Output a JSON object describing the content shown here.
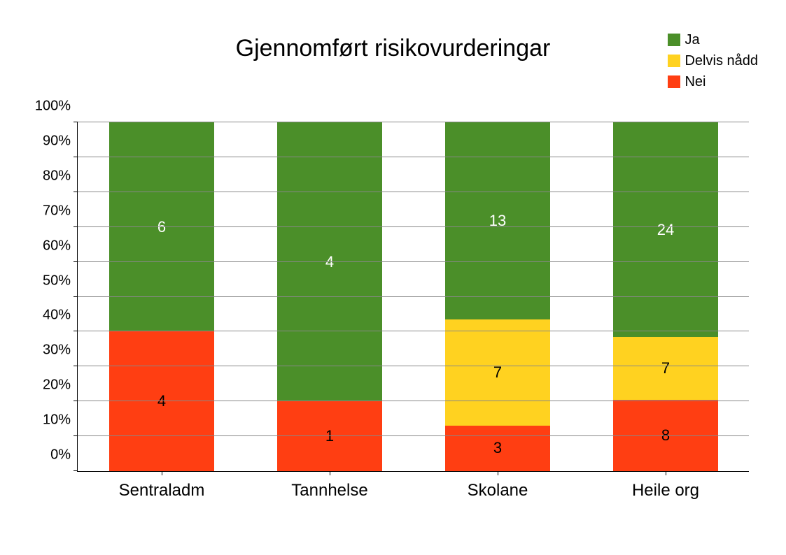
{
  "title": "Gjennomført risikovurderingar",
  "legend": {
    "ja": {
      "label": "Ja",
      "color": "#4b8f29"
    },
    "delvis": {
      "label": "Delvis nådd",
      "color": "#ffd220"
    },
    "nei": {
      "label": "Nei",
      "color": "#ff3e12"
    }
  },
  "yticks": [
    "0%",
    "10%",
    "20%",
    "30%",
    "40%",
    "50%",
    "60%",
    "70%",
    "80%",
    "90%",
    "100%"
  ],
  "categories": [
    "Sentraladm",
    "Tannhelse",
    "Skolane",
    "Heile org"
  ],
  "chart_data": {
    "type": "bar",
    "title": "Gjennomført risikovurderingar",
    "xlabel": "",
    "ylabel": "",
    "ylim": [
      0,
      100
    ],
    "categories": [
      "Sentraladm",
      "Tannhelse",
      "Skolane",
      "Heile org"
    ],
    "series": [
      {
        "name": "Nei",
        "values": [
          4,
          1,
          3,
          8
        ],
        "color": "#ff3e12"
      },
      {
        "name": "Delvis nådd",
        "values": [
          0,
          0,
          7,
          7
        ],
        "color": "#ffd220"
      },
      {
        "name": "Ja",
        "values": [
          6,
          4,
          13,
          24
        ],
        "color": "#4b8f29"
      }
    ],
    "stacked": true,
    "percent": true
  }
}
